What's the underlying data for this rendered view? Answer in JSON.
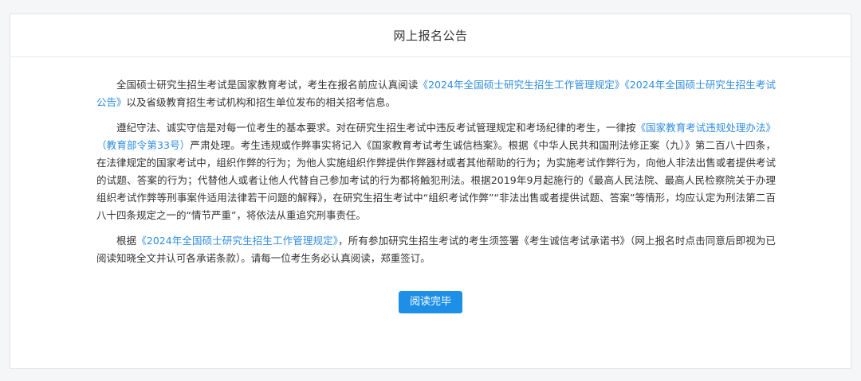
{
  "header": {
    "title": "网上报名公告"
  },
  "paragraphs": [
    {
      "t1": "全国硕士研究生招生考试是国家教育考试，考生在报名前应认真阅读",
      "link1": "《2024年全国硕士研究生招生工作管理规定》",
      "link2": "《2024年全国硕士研究生招生考试公告》",
      "t2": "以及省级教育招生考试机构和招生单位发布的相关招考信息。"
    },
    {
      "t1": "遵纪守法、诚实守信是对每一位考生的基本要求。对在研究生招生考试中违反考试管理规定和考场纪律的考生，一律按",
      "link1": "《国家教育考试违规处理办法》（教育部令第33号）",
      "t2": "严肃处理。考生违规或作弊事实将记入《国家教育考试考生诚信档案》。根据《中华人民共和国刑法修正案（九）》第二百八十四条，在法律规定的国家考试中，组织作弊的行为；为他人实施组织作弊提供作弊器材或者其他帮助的行为；为实施考试作弊行为，向他人非法出售或者提供考试的试题、答案的行为；代替他人或者让他人代替自己参加考试的行为都将触犯刑法。根据2019年9月起施行的《最高人民法院、最高人民检察院关于办理组织考试作弊等刑事案件适用法律若干问题的解释》，在研究生招生考试中“组织考试作弊”“非法出售或者提供试题、答案”等情形，均应认定为刑法第二百八十四条规定之一的“情节严重”，将依法从重追究刑事责任。"
    },
    {
      "t1": "根据",
      "link1": "《2024年全国硕士研究生招生工作管理规定》",
      "t2": "，所有参加研究生招生考试的考生须签署《考生诚信考试承诺书》（网上报名时点击同意后即视为已阅读知晓全文并认可各承诺条款）。请每一位考生务必认真阅读，郑重签订。"
    }
  ],
  "button": {
    "label": "阅读完毕"
  },
  "colors": {
    "link": "#2f8ce0",
    "button": "#1e8fe6"
  }
}
